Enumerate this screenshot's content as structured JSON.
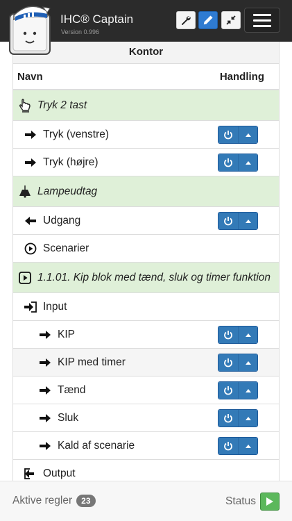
{
  "header": {
    "app_title": "IHC® Captain",
    "version": "Version 0.996",
    "tools": [
      {
        "icon": "wrench-icon",
        "active": false
      },
      {
        "icon": "pencil-icon",
        "active": true
      },
      {
        "icon": "compress-icon",
        "active": false
      }
    ],
    "menu_icon": "hamburger-menu-icon"
  },
  "panel": {
    "title": "Kontor",
    "col_name": "Navn",
    "col_action": "Handling"
  },
  "rows": [
    {
      "label": "Tryk 2 tast",
      "type": "group",
      "icon": "hand-point-icon"
    },
    {
      "label": "Tryk (venstre)",
      "type": "item",
      "level": 1,
      "icon": "arrow-right-icon",
      "actions": true
    },
    {
      "label": "Tryk (højre)",
      "type": "item",
      "level": 1,
      "icon": "arrow-right-icon",
      "actions": true
    },
    {
      "label": "Lampeudtag",
      "type": "group",
      "icon": "lamp-icon"
    },
    {
      "label": "Udgang",
      "type": "item",
      "level": 1,
      "icon": "arrow-left-icon",
      "actions": true
    },
    {
      "label": "Scenarier",
      "type": "item",
      "level": 1,
      "icon": "play-circle-icon",
      "actions": false
    },
    {
      "label": "1.1.01. Kip blok med tænd, sluk og timer funktion",
      "type": "group",
      "icon": "play-square-icon"
    },
    {
      "label": "Input",
      "type": "item",
      "level": 1,
      "icon": "sign-in-icon",
      "actions": false
    },
    {
      "label": "KIP",
      "type": "item",
      "level": 2,
      "icon": "arrow-right-icon",
      "actions": true
    },
    {
      "label": "KIP med timer",
      "type": "item",
      "level": 2,
      "icon": "arrow-right-icon",
      "actions": true,
      "hover": true
    },
    {
      "label": "Tænd",
      "type": "item",
      "level": 2,
      "icon": "arrow-right-icon",
      "actions": true
    },
    {
      "label": "Sluk",
      "type": "item",
      "level": 2,
      "icon": "arrow-right-icon",
      "actions": true
    },
    {
      "label": "Kald af scenarie",
      "type": "item",
      "level": 2,
      "icon": "arrow-right-icon",
      "actions": true
    },
    {
      "label": "Output",
      "type": "item",
      "level": 1,
      "icon": "sign-out-icon",
      "actions": false
    }
  ],
  "footer": {
    "active_rules_label": "Aktive regler",
    "active_rules_count": "23",
    "status_label": "Status"
  },
  "colors": {
    "topbar": "#2b2b2b",
    "group_row": "#dff0d8",
    "action_button": "#337ab7",
    "status_play": "#5cb85c"
  }
}
